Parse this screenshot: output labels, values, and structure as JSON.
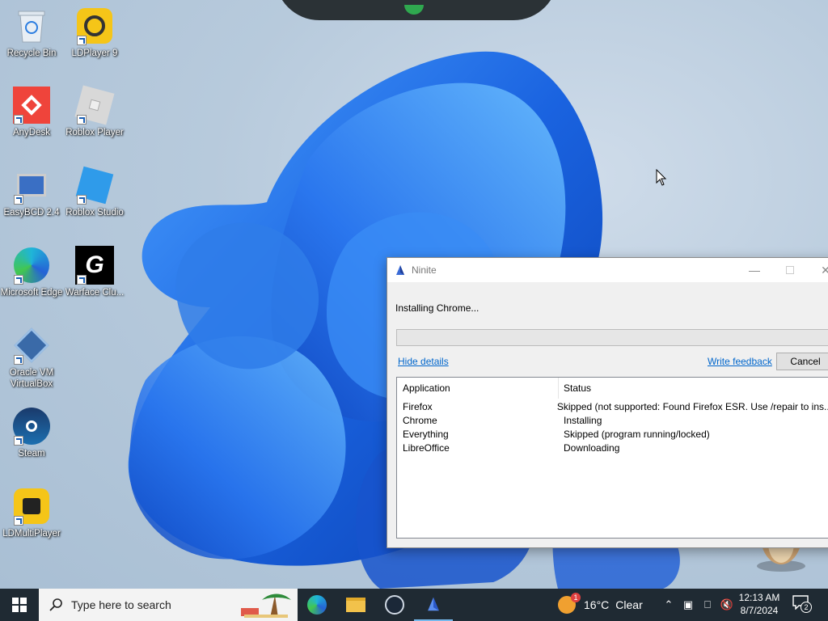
{
  "desktop": {
    "icons": [
      {
        "label": "Recycle Bin"
      },
      {
        "label": "LDPlayer 9"
      },
      {
        "label": "AnyDesk"
      },
      {
        "label": "Roblox Player"
      },
      {
        "label": "EasyBCD 2.4"
      },
      {
        "label": "Roblox Studio"
      },
      {
        "label": "Microsoft Edge"
      },
      {
        "label": "Warface Clu..."
      },
      {
        "label": "Oracle VM VirtualBox"
      },
      {
        "label": "Steam"
      },
      {
        "label": "LDMultiPlayer"
      }
    ]
  },
  "window": {
    "title": "Ninite",
    "status": "Installing Chrome...",
    "progress": 0,
    "hide_details": "Hide details",
    "write_feedback": "Write feedback",
    "cancel": "Cancel",
    "table": {
      "headers": [
        "Application",
        "Status"
      ],
      "rows": [
        {
          "app": "Firefox",
          "status": "Skipped (not supported: Found Firefox ESR. Use /repair to ins..."
        },
        {
          "app": "Chrome",
          "status": "Installing"
        },
        {
          "app": "Everything",
          "status": "Skipped (program running/locked)"
        },
        {
          "app": "LibreOffice",
          "status": "Downloading"
        }
      ]
    }
  },
  "taskbar": {
    "search_placeholder": "Type here to search",
    "weather_temp": "16°C",
    "weather_desc": "Clear",
    "weather_badge": "1",
    "time": "12:13 AM",
    "date": "8/7/2024",
    "notification_count": "2"
  },
  "colors": {
    "taskbar": "#1f2a33",
    "link": "#0066cc",
    "wallpaper_bloom": "#1a63e0"
  }
}
